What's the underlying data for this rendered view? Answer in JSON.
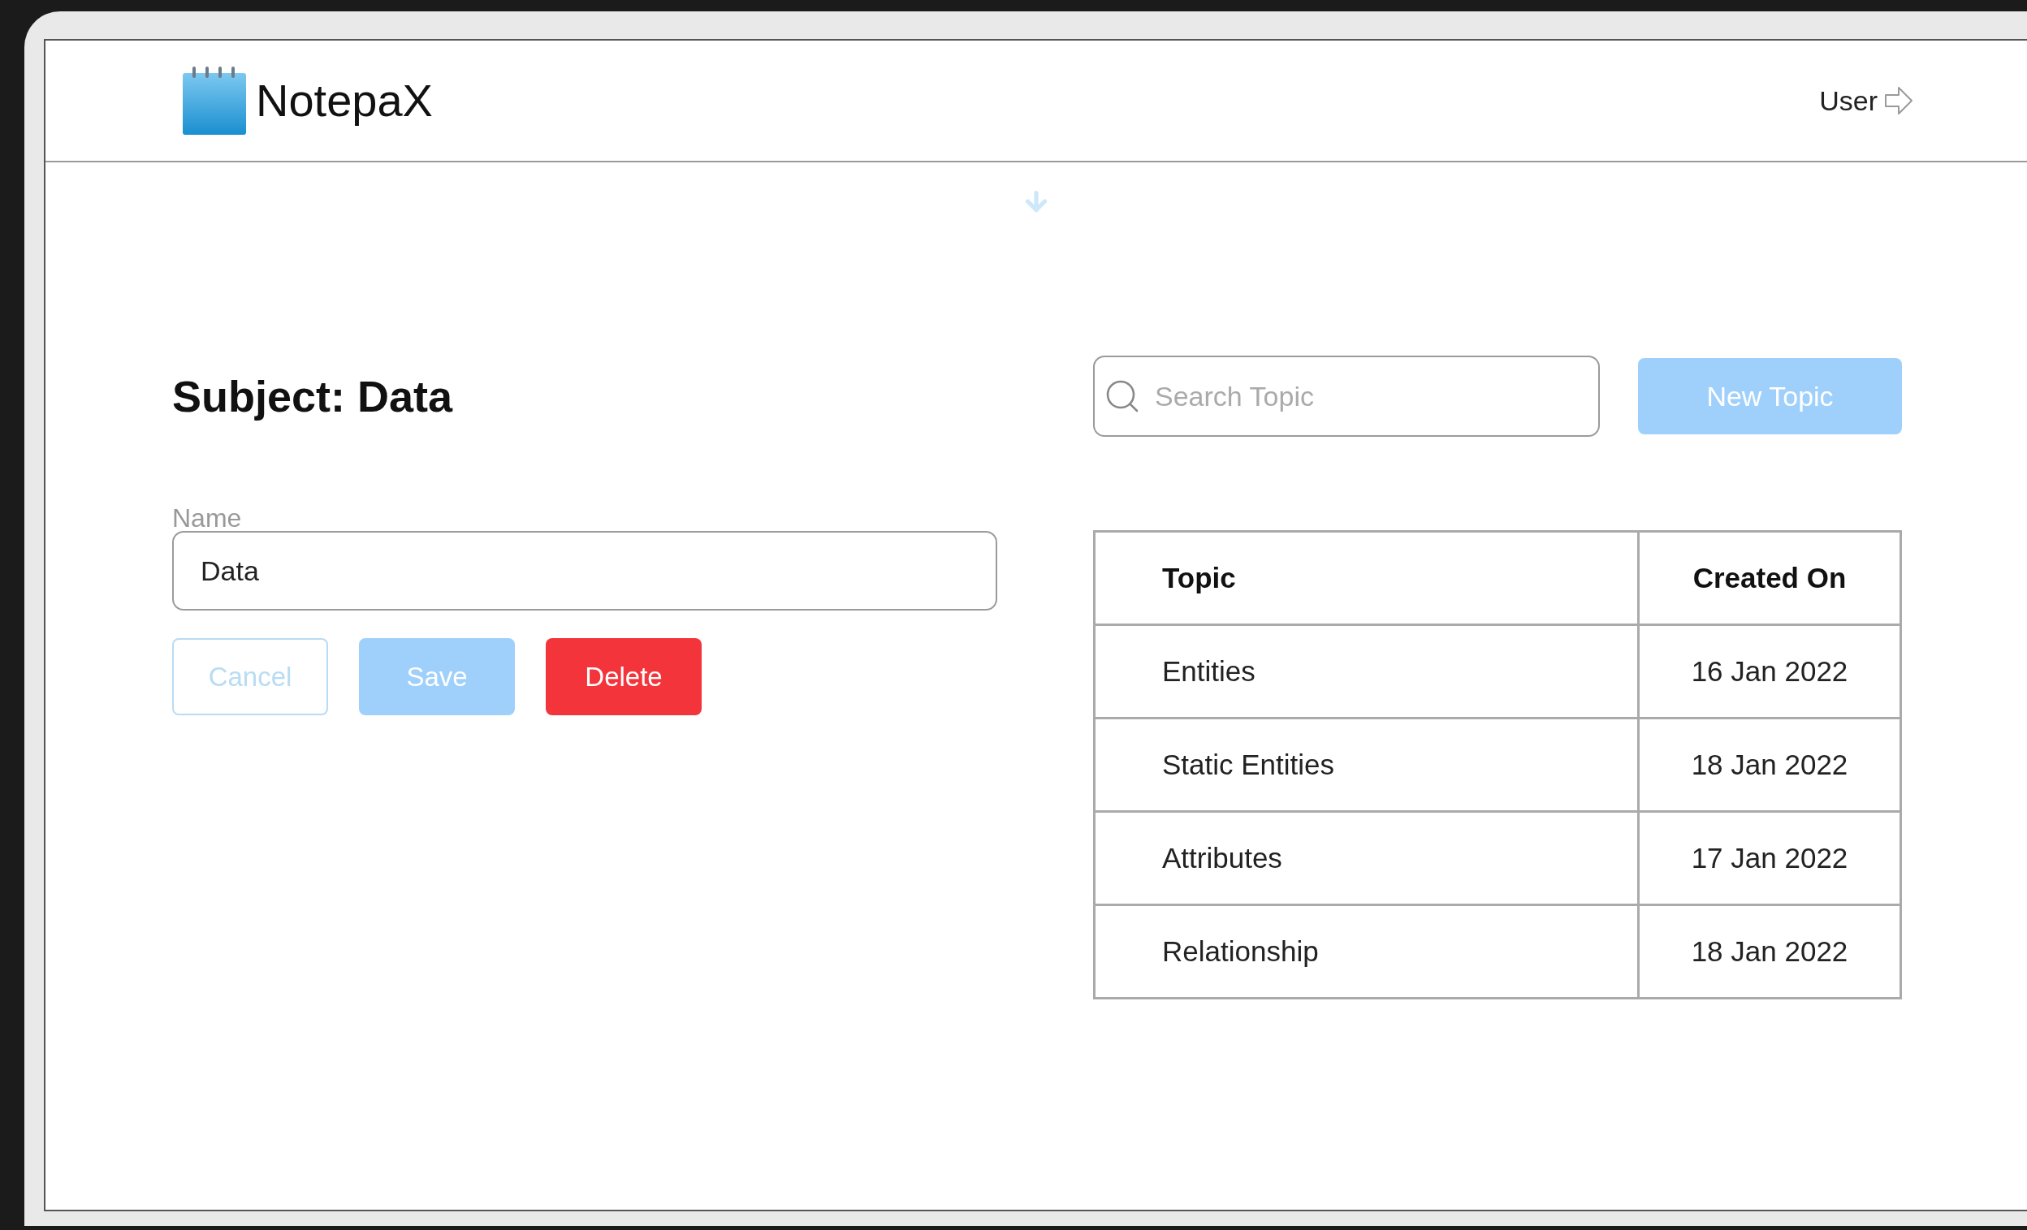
{
  "header": {
    "app_name": "NotepaX",
    "user_label": "User"
  },
  "subject": {
    "title": "Subject: Data",
    "field": {
      "label": "Name",
      "value": "Data"
    },
    "buttons": [
      {
        "label": "Cancel",
        "kind": "outline",
        "disabled": true
      },
      {
        "label": "Save",
        "kind": "primary",
        "disabled": true
      },
      {
        "label": "Delete",
        "kind": "danger",
        "disabled": false
      }
    ]
  },
  "search": {
    "placeholder": "Search Topic"
  },
  "new_topic_button": {
    "label": "New Topic",
    "disabled": true
  },
  "table": {
    "columns": [
      "Topic",
      "Created On"
    ],
    "rows": [
      {
        "topic": "Entities",
        "created_on": "16 Jan 2022"
      },
      {
        "topic": "Static Entities",
        "created_on": "18 Jan 2022"
      },
      {
        "topic": "Attributes",
        "created_on": "17 Jan 2022"
      },
      {
        "topic": "Relationship",
        "created_on": "18 Jan 2022"
      }
    ]
  }
}
